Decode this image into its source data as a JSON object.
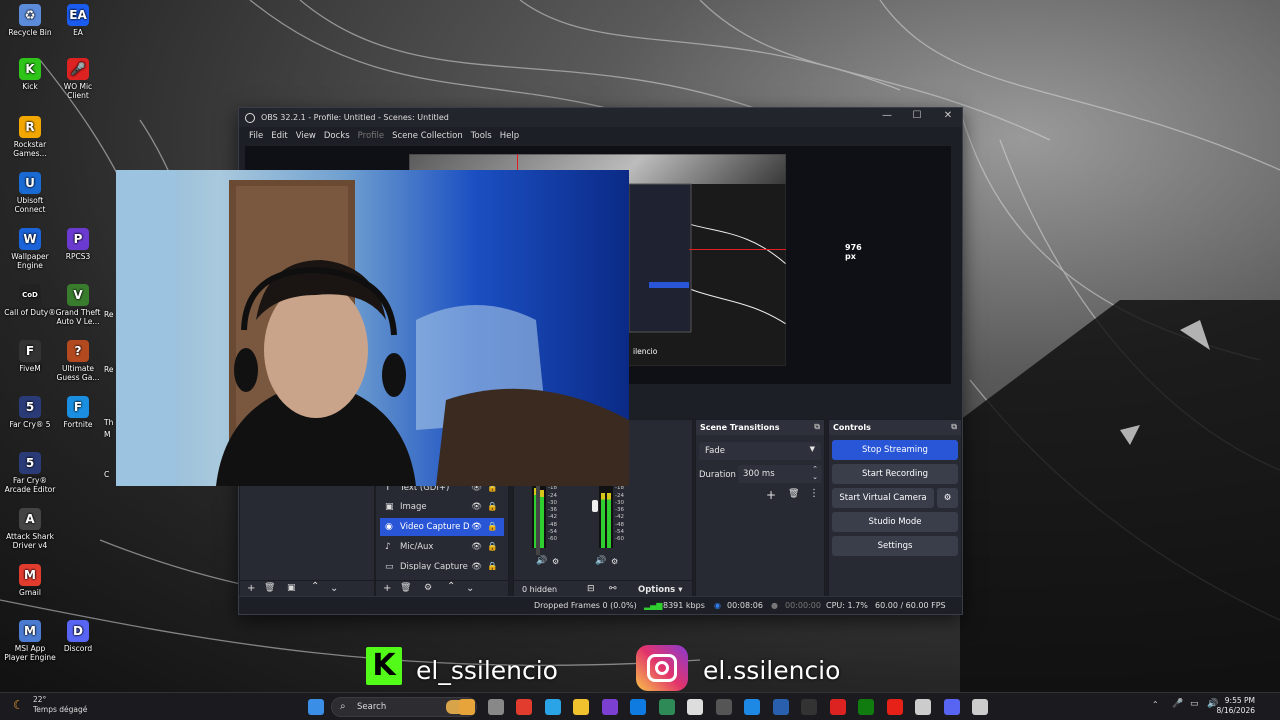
{
  "desktop": {
    "icons": [
      {
        "label": "Recycle Bin",
        "glyph": "♻",
        "color": "#5b8bd9"
      },
      {
        "label": "EA",
        "glyph": "EA",
        "color": "#1b5cf0"
      },
      {
        "label": "Kick",
        "glyph": "K",
        "color": "#2ec41a"
      },
      {
        "label": "WO Mic Client",
        "glyph": "🎤",
        "color": "#d22"
      },
      {
        "label": "Rockstar Games...",
        "glyph": "R",
        "color": "#f2a600"
      },
      {
        "label": "Ubisoft Connect",
        "glyph": "U",
        "color": "#1a6ad3"
      },
      {
        "label": "Wallpaper Engine",
        "glyph": "W",
        "color": "#1b63d9"
      },
      {
        "label": "RPCS3",
        "glyph": "P",
        "color": "#6b3bd1"
      },
      {
        "label": "Call of Duty®",
        "glyph": "CoD",
        "color": "#222"
      },
      {
        "label": "Grand Theft Auto V Le...",
        "glyph": "V",
        "color": "#3a7c2e"
      },
      {
        "label": "FiveM",
        "glyph": "F",
        "color": "#333"
      },
      {
        "label": "Ultimate Guess Ga...",
        "glyph": "?",
        "color": "#b34a1f"
      },
      {
        "label": "Far Cry® 5",
        "glyph": "5",
        "color": "#2a3b78"
      },
      {
        "label": "Fortnite",
        "glyph": "F",
        "color": "#1a8ee0"
      },
      {
        "label": "Far Cry® Arcade Editor",
        "glyph": "5",
        "color": "#2a3b78"
      },
      {
        "label": "Attack Shark Driver v4",
        "glyph": "A",
        "color": "#444"
      },
      {
        "label": "Gmail",
        "glyph": "M",
        "color": "#e23c2f"
      },
      {
        "label": "MSI App Player Engine",
        "glyph": "M",
        "color": "#4a7bd1"
      },
      {
        "label": "Discord",
        "glyph": "D",
        "color": "#5865f2"
      }
    ],
    "partial_labels": [
      "Re",
      "Re",
      "Th",
      "M",
      "C"
    ]
  },
  "obs": {
    "title": "OBS 32.2.1 - Profile: Untitled - Scenes: Untitled",
    "window_controls": {
      "minimize": "—",
      "maximize": "☐",
      "close": "✕"
    },
    "menu": [
      "File",
      "Edit",
      "View",
      "Docks",
      "Profile",
      "Scene Collection",
      "Tools",
      "Help"
    ],
    "preview": {
      "measure_label": "976 px",
      "source_label": "ilencio"
    },
    "sources": {
      "items": [
        {
          "name": "Text (GDI+)",
          "icon": "T"
        },
        {
          "name": "Image",
          "icon": "▣"
        },
        {
          "name": "Video Capture D",
          "icon": "◉"
        },
        {
          "name": "Mic/Aux",
          "icon": "♪"
        },
        {
          "name": "Display Capture",
          "icon": "▭"
        }
      ],
      "selected_index": 2
    },
    "mixer": {
      "scale": [
        "-12",
        "-18",
        "-24",
        "-30",
        "-36",
        "-42",
        "-48",
        "-54",
        "-60"
      ],
      "hidden_label": "0 hidden",
      "options_label": "Options ▾"
    },
    "transitions": {
      "header": "Scene Transitions",
      "selected": "Fade",
      "duration_label": "Duration",
      "duration_value": "300 ms"
    },
    "controls": {
      "header": "Controls",
      "stop_streaming": "Stop Streaming",
      "start_recording": "Start Recording",
      "start_virtual_camera": "Start Virtual Camera",
      "studio_mode": "Studio Mode",
      "settings": "Settings"
    },
    "status": {
      "dropped_frames": "Dropped Frames 0 (0.0%)",
      "bitrate": "8391 kbps",
      "stream_time": "00:08:06",
      "rec_time": "00:00:00",
      "cpu": "CPU: 1.7%",
      "fps": "60.00 / 60.00 FPS"
    }
  },
  "overlay": {
    "kick_logo": "K",
    "kick_name": "el_ssilencio",
    "instagram_name": "el.ssilencio"
  },
  "taskbar": {
    "weather_temp": "22°",
    "weather_desc": "Temps dégagé",
    "search_placeholder": "Search",
    "time": "9:55 PM",
    "date": "8/16/2026"
  }
}
